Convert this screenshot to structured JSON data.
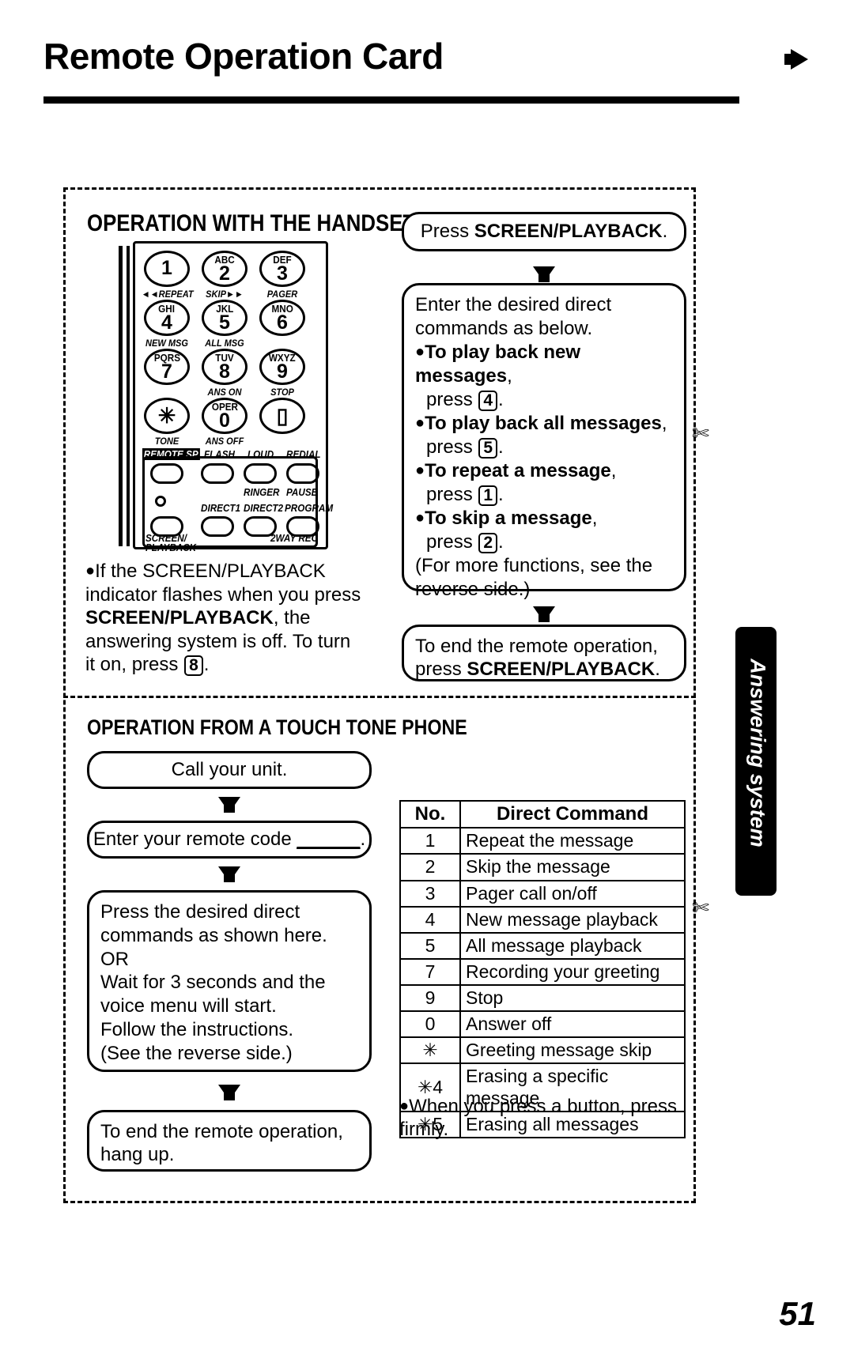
{
  "header": {
    "title": "Remote Operation Card",
    "arrow_icon": "right-arrow-icon"
  },
  "page_number": "51",
  "side_tab": {
    "label": "Answering system"
  },
  "sections": {
    "handset": {
      "heading": "OPERATION WITH THE HANDSET",
      "keypad": {
        "keys": [
          {
            "letters": "",
            "digit": "1",
            "label": "◄◄REPEAT"
          },
          {
            "letters": "ABC",
            "digit": "2",
            "label": "SKIP►►"
          },
          {
            "letters": "DEF",
            "digit": "3",
            "label": "PAGER"
          },
          {
            "letters": "GHI",
            "digit": "4",
            "label": "NEW MSG"
          },
          {
            "letters": "JKL",
            "digit": "5",
            "label": "ALL MSG"
          },
          {
            "letters": "MNO",
            "digit": "6",
            "label": ""
          },
          {
            "letters": "PQRS",
            "digit": "7",
            "label": ""
          },
          {
            "letters": "TUV",
            "digit": "8",
            "label": "ANS ON"
          },
          {
            "letters": "WXYZ",
            "digit": "9",
            "label": "STOP"
          },
          {
            "letters": "",
            "digit": "✳",
            "label": "TONE"
          },
          {
            "letters": "OPER",
            "digit": "0",
            "label": "ANS OFF"
          },
          {
            "letters": "",
            "digit": "▯",
            "label": ""
          }
        ],
        "function_labels": {
          "remote_sp": "REMOTE SP",
          "flash": "FLASH",
          "loud": "LOUD",
          "redial": "REDIAL",
          "ringer": "RINGER",
          "pause": "PAUSE",
          "direct1": "DIRECT1",
          "direct2": "DIRECT2",
          "program": "PROGRAM",
          "screen_playback_line1": "SCREEN/",
          "screen_playback_line2": "PLAYBACK",
          "two_way_rec": "2WAY REC"
        }
      },
      "note_bullet": "●",
      "note_line1": "If the SCREEN/PLAYBACK",
      "note_line2": "indicator flashes when you press",
      "note_bold": "SCREEN/PLAYBACK",
      "note_line3_tail": ", the",
      "note_line4": "answering system is off. To turn",
      "note_line5_prefix": "it on, press ",
      "note_line5_key": "8",
      "note_line5_tail": "."
    },
    "handset_flow": {
      "step1_prefix": "Press ",
      "step1_bold": "SCREEN/PLAYBACK",
      "step1_tail": ".",
      "step2_line1": "Enter the desired direct",
      "step2_line2": "commands as below.",
      "step2_items": [
        {
          "bold": "To play back new messages",
          "tail": ",",
          "press_prefix": "press ",
          "key": "4",
          "press_tail": "."
        },
        {
          "bold": "To play back all messages",
          "tail": ",",
          "press_prefix": "press ",
          "key": "5",
          "press_tail": "."
        },
        {
          "bold": "To repeat a message",
          "tail": ",",
          "press_prefix": "press ",
          "key": "1",
          "press_tail": "."
        },
        {
          "bold": "To skip a message",
          "tail": ",",
          "press_prefix": "press ",
          "key": "2",
          "press_tail": "."
        }
      ],
      "step2_footer_line1": "(For more functions, see the",
      "step2_footer_line2": "reverse side.)",
      "step3_line1": "To end the remote operation,",
      "step3_prefix": "press ",
      "step3_bold": "SCREEN/PLAYBACK",
      "step3_tail": "."
    },
    "touchtone": {
      "heading": "OPERATION FROM A TOUCH TONE PHONE",
      "step1": "Call your unit.",
      "step2_prefix": "Enter your remote code ",
      "step2_blank": "______",
      "step2_tail": ".",
      "step3_line1": "Press the desired direct",
      "step3_line2": "commands as shown here.",
      "step3_line3": "OR",
      "step3_line4": "Wait for 3 seconds and the",
      "step3_line5": "voice menu will start.",
      "step3_line6": "Follow the instructions.",
      "step3_line7": "(See the reverse side.)",
      "step4_line1": "To end the remote operation,",
      "step4_line2": "hang up."
    },
    "command_table": {
      "headers": [
        "No.",
        "Direct Command"
      ],
      "rows": [
        [
          "1",
          "Repeat the message"
        ],
        [
          "2",
          "Skip the message"
        ],
        [
          "3",
          "Pager call on/off"
        ],
        [
          "4",
          "New message playback"
        ],
        [
          "5",
          "All message playback"
        ],
        [
          "7",
          "Recording your greeting"
        ],
        [
          "9",
          "Stop"
        ],
        [
          "0",
          "Answer off"
        ],
        [
          "✳",
          "Greeting message skip"
        ],
        [
          "✳4",
          "Erasing a specific message"
        ],
        [
          "✳5",
          "Erasing all messages"
        ]
      ],
      "note_bullet": "●",
      "note_line1": "When you press a button, press",
      "note_line2": "firmly."
    }
  }
}
